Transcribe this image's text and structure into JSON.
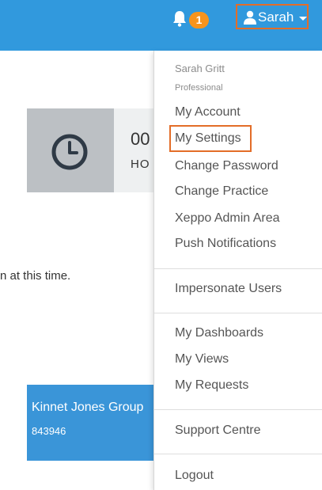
{
  "header": {
    "notification_count": "1",
    "user_label": "Sarah"
  },
  "dashboard": {
    "stat_value": "00",
    "stat_label": "HO",
    "message_fragment": "n at this time.",
    "practice_name": "Kinnet Jones Group",
    "practice_id": "843946"
  },
  "user_menu": {
    "full_name": "Sarah Gritt",
    "role": "Professional",
    "items": [
      "My Account",
      "My Settings",
      "Change Password",
      "Change Practice",
      "Xeppo Admin Area",
      "Push Notifications",
      "Impersonate Users",
      "My Dashboards",
      "My Views",
      "My Requests",
      "Support Centre",
      "Logout"
    ],
    "highlighted_item": "My Settings"
  },
  "colors": {
    "topbar": "#3199dd",
    "badge": "#f7941d",
    "highlight_border": "#e36d28",
    "practice_card": "#3a95d8"
  }
}
